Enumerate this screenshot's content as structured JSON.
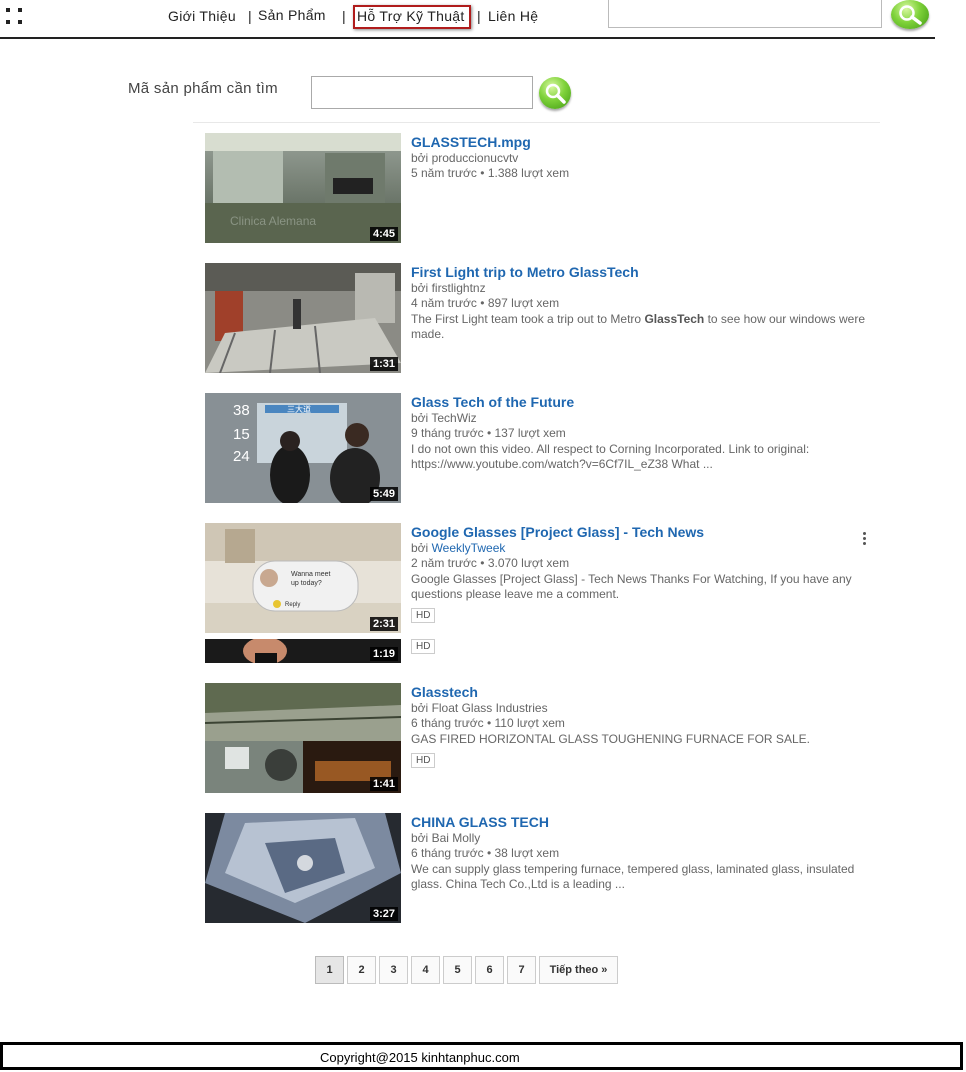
{
  "nav": {
    "items": [
      "Giới Thiệu",
      "Sản Phẩm",
      "Hỗ Trợ Kỹ Thuật",
      "Liên Hệ"
    ],
    "separator": "|",
    "active": "Hỗ Trợ Kỹ Thuật"
  },
  "top_search": {
    "value": "",
    "button_icon": "search-icon"
  },
  "product_search": {
    "label": "Mã sản phẩm cần tìm",
    "value": "",
    "button_icon": "search-icon"
  },
  "results": [
    {
      "title": "GLASSTECH.mpg",
      "by": "bởi",
      "channel": "produccionucvtv",
      "age": "5 năm trước",
      "views": "1.388 lượt xem",
      "description": "",
      "duration": "4:45"
    },
    {
      "title": "First Light trip to Metro GlassTech",
      "by": "bởi",
      "channel": "firstlightnz",
      "age": "4 năm trước",
      "views": "897 lượt xem",
      "description_pre": "The First Light team took a trip out to Metro ",
      "description_bold": "GlassTech",
      "description_post": " to see how our windows were made.",
      "duration": "1:31"
    },
    {
      "title": "Glass Tech of the Future",
      "by": "bởi",
      "channel": "TechWiz",
      "age": "9 tháng trước",
      "views": "137 lượt xem",
      "description": "I do not own this video. All respect to Corning Incorporated. Link to original: https://www.youtube.com/watch?v=6Cf7IL_eZ38 What ...",
      "duration": "5:49"
    },
    {
      "title": "Google Glasses [Project Glass] - Tech News",
      "by": "bởi",
      "channel": "WeeklyTweek",
      "age": "2 năm trước",
      "views": "3.070 lượt xem",
      "description": "Google Glasses [Project Glass] - Tech News Thanks For Watching, If you have any questions please leave me a comment.",
      "duration": "2:31",
      "badge": "HD",
      "bubble_line1": "Wanna meet",
      "bubble_line2": "up today?",
      "bubble_reply": "Reply"
    },
    {
      "title": "",
      "duration": "1:19",
      "badge": "HD"
    },
    {
      "title": "Glasstech",
      "by": "bởi",
      "channel": "Float Glass Industries",
      "age": "6 tháng trước",
      "views": "110 lượt xem",
      "description": "GAS FIRED HORIZONTAL GLASS TOUGHENING FURNACE FOR SALE.",
      "duration": "1:41",
      "badge": "HD"
    },
    {
      "title": "CHINA GLASS TECH",
      "by": "bởi",
      "channel": "Bai Molly",
      "age": "6 tháng trước",
      "views": "38 lượt xem",
      "description": "We can supply glass tempering furnace, tempered glass, laminated glass, insulated glass. China Tech Co.,Ltd is a leading ...",
      "duration": "3:27"
    }
  ],
  "thumb_text": {
    "t1_watermark": "Clinica Alemana",
    "t3_n1": "38",
    "t3_n2": "15",
    "t3_n3": "24",
    "t3_sign": "三大道"
  },
  "meta_sep": "•",
  "pagination": {
    "pages": [
      "1",
      "2",
      "3",
      "4",
      "5",
      "6",
      "7"
    ],
    "current": "1",
    "next": "Tiếp theo »"
  },
  "footer": {
    "text": "Copyright@2015 kinhtanphuc.com"
  }
}
